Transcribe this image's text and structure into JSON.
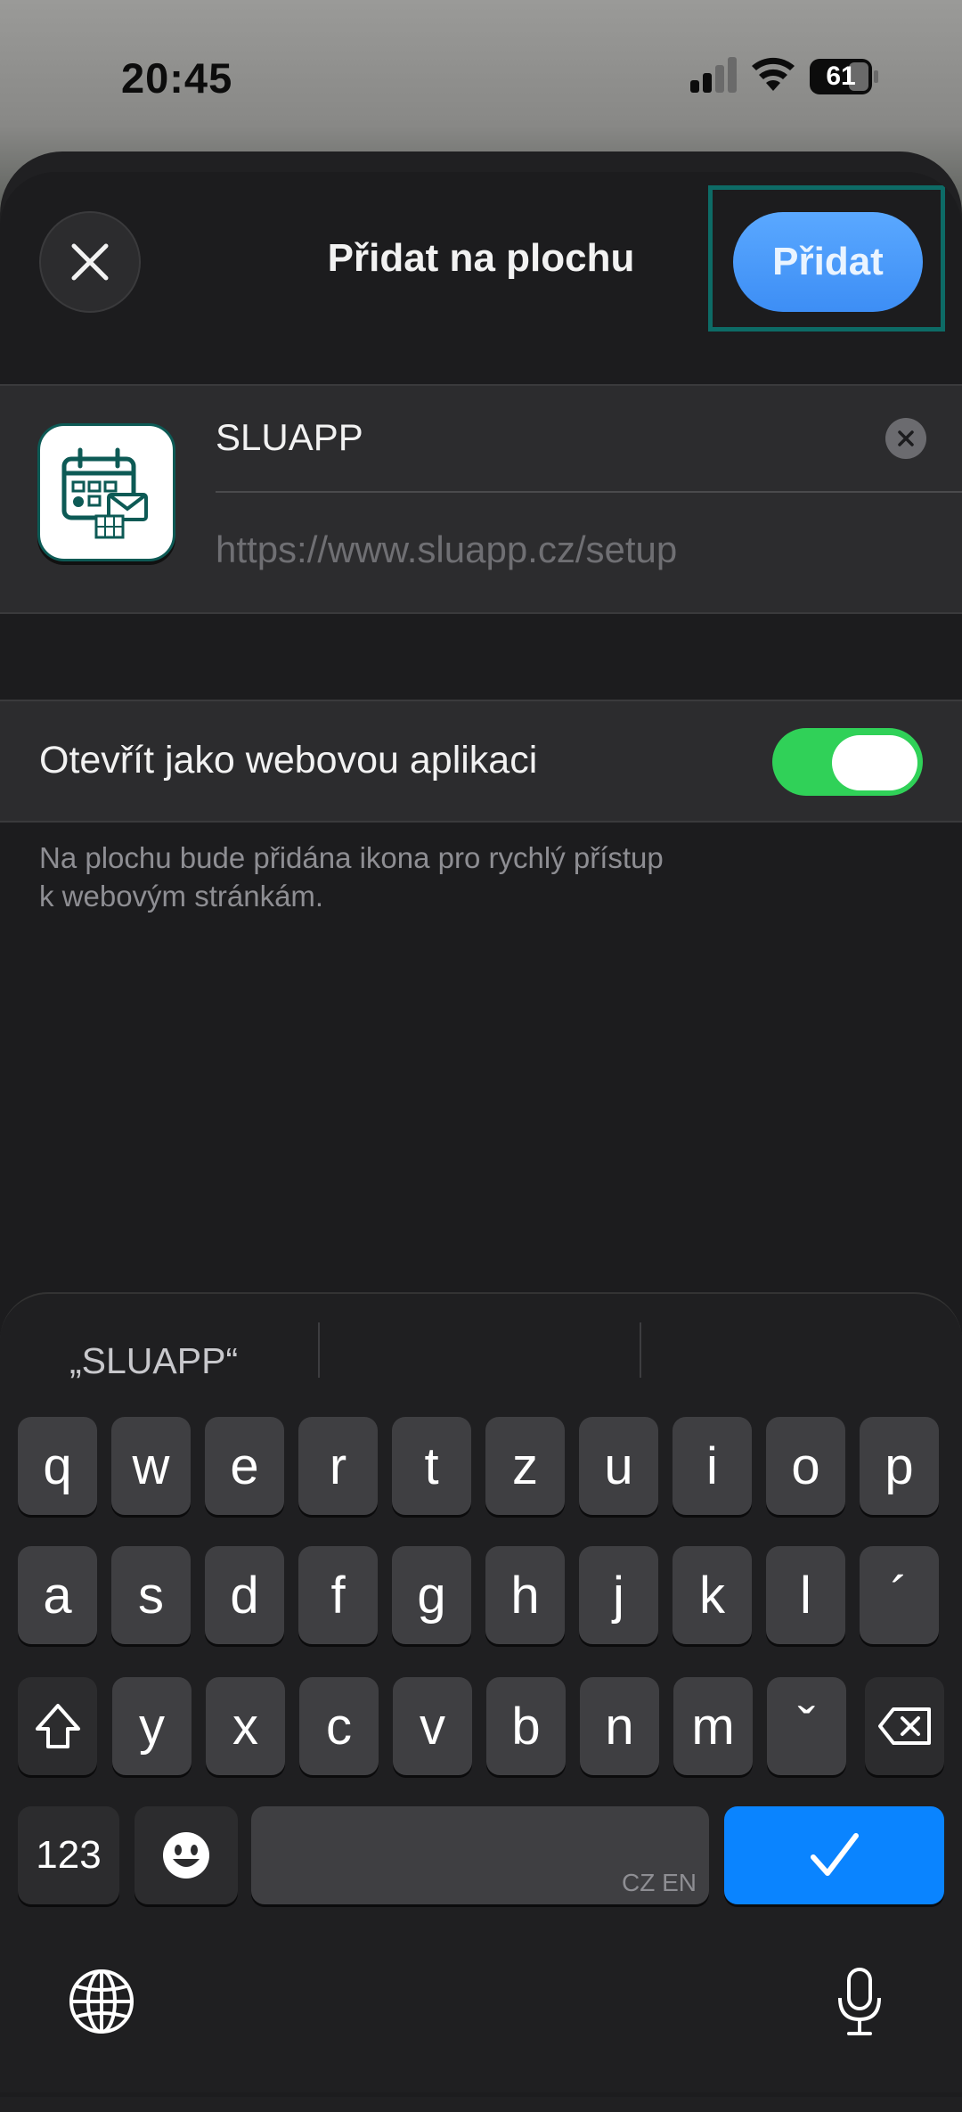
{
  "status_bar": {
    "time": "20:45",
    "battery_level": "61",
    "signal_icon": "cellular-signal-icon",
    "wifi_icon": "wifi-icon"
  },
  "sheet": {
    "title": "Přidat na plochu",
    "close_icon": "close-icon",
    "add_label": "Přidat"
  },
  "app_card": {
    "icon": "calendar-mail-icon",
    "name_value": "SLUAPP",
    "clear_icon": "clear-text-icon",
    "url": "https://www.sluapp.cz/setup"
  },
  "web_app": {
    "label": "Otevřít jako webovou aplikaci",
    "enabled": true,
    "hint_line1": "Na plochu bude přidána ikona pro rychlý přístup",
    "hint_line2": "k webovým stránkám."
  },
  "keyboard": {
    "suggestion": "„SLUAPP“",
    "row1": [
      "q",
      "w",
      "e",
      "r",
      "t",
      "z",
      "u",
      "i",
      "o",
      "p"
    ],
    "row2": [
      "a",
      "s",
      "d",
      "f",
      "g",
      "h",
      "j",
      "k",
      "l",
      "´"
    ],
    "row3": [
      "y",
      "x",
      "c",
      "v",
      "b",
      "n",
      "m",
      "ˇ"
    ],
    "numbers_label": "123",
    "space_lang": "CZ EN",
    "shift_icon": "shift-icon",
    "delete_icon": "backspace-icon",
    "emoji_icon": "emoji-icon",
    "done_icon": "checkmark-icon",
    "globe_icon": "globe-icon",
    "mic_icon": "microphone-icon"
  },
  "colors": {
    "accent": "#0a84ff",
    "toggle_on": "#30d158",
    "highlight_frame": "#0d6b66"
  }
}
